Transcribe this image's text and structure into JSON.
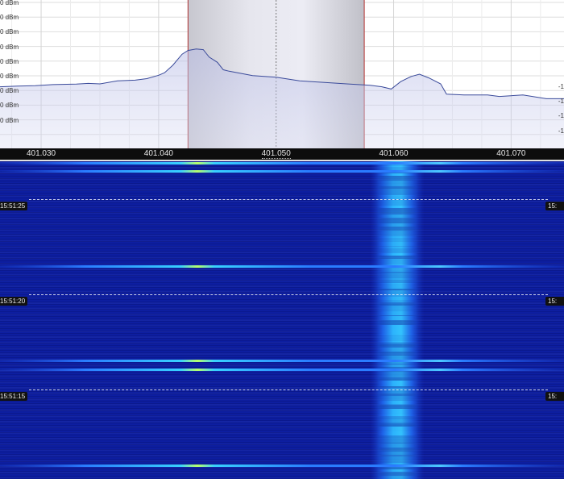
{
  "spectrum": {
    "level_labels": [
      "0 dBm",
      "0 dBm",
      "0 dBm",
      "0 dBm",
      "0 dBm",
      "0 dBm",
      "0 dBm",
      "0 dBm",
      "0 dBm"
    ],
    "right_labels": [
      "-1",
      "-1",
      "-1",
      "-1"
    ],
    "filter_passband_mhz": [
      401.0425,
      401.0575
    ],
    "filter_center_mhz": 401.05,
    "x_range_mhz": [
      401.0265,
      401.0745
    ],
    "trace": [
      [
        401.0265,
        0.585
      ],
      [
        401.028,
        0.58
      ],
      [
        401.0295,
        0.577
      ],
      [
        401.031,
        0.57
      ],
      [
        401.033,
        0.567
      ],
      [
        401.034,
        0.562
      ],
      [
        401.035,
        0.565
      ],
      [
        401.0365,
        0.545
      ],
      [
        401.038,
        0.54
      ],
      [
        401.039,
        0.53
      ],
      [
        401.04,
        0.507
      ],
      [
        401.0405,
        0.49
      ],
      [
        401.0412,
        0.44
      ],
      [
        401.042,
        0.365
      ],
      [
        401.0425,
        0.34
      ],
      [
        401.0432,
        0.33
      ],
      [
        401.0438,
        0.335
      ],
      [
        401.0443,
        0.385
      ],
      [
        401.045,
        0.42
      ],
      [
        401.0455,
        0.47
      ],
      [
        401.046,
        0.48
      ],
      [
        401.048,
        0.51
      ],
      [
        401.05,
        0.52
      ],
      [
        401.052,
        0.545
      ],
      [
        401.054,
        0.555
      ],
      [
        401.056,
        0.565
      ],
      [
        401.058,
        0.575
      ],
      [
        401.059,
        0.585
      ],
      [
        401.0598,
        0.6
      ],
      [
        401.0606,
        0.55
      ],
      [
        401.0615,
        0.515
      ],
      [
        401.0622,
        0.5
      ],
      [
        401.063,
        0.525
      ],
      [
        401.064,
        0.565
      ],
      [
        401.0645,
        0.635
      ],
      [
        401.066,
        0.64
      ],
      [
        401.068,
        0.64
      ],
      [
        401.069,
        0.65
      ],
      [
        401.071,
        0.64
      ],
      [
        401.073,
        0.665
      ],
      [
        401.0745,
        0.665
      ]
    ]
  },
  "frequency_axis": {
    "ticks": [
      {
        "value": 401.03,
        "label": "401.030"
      },
      {
        "value": 401.04,
        "label": "401.040"
      },
      {
        "value": 401.05,
        "label": "401.050"
      },
      {
        "value": 401.06,
        "label": "401.060"
      },
      {
        "value": 401.07,
        "label": "401.070"
      }
    ]
  },
  "waterfall": {
    "time_markers": [
      {
        "label": "15:51:25",
        "right_label": "15:"
      },
      {
        "label": "15:51:20",
        "right_label": "15:"
      },
      {
        "label": "15:51:15",
        "right_label": "15:"
      }
    ],
    "carrier_center_mhz": 401.0603,
    "carrier_bandwidth_mhz": 0.0035,
    "burst_center_mhz": 401.0405
  }
}
